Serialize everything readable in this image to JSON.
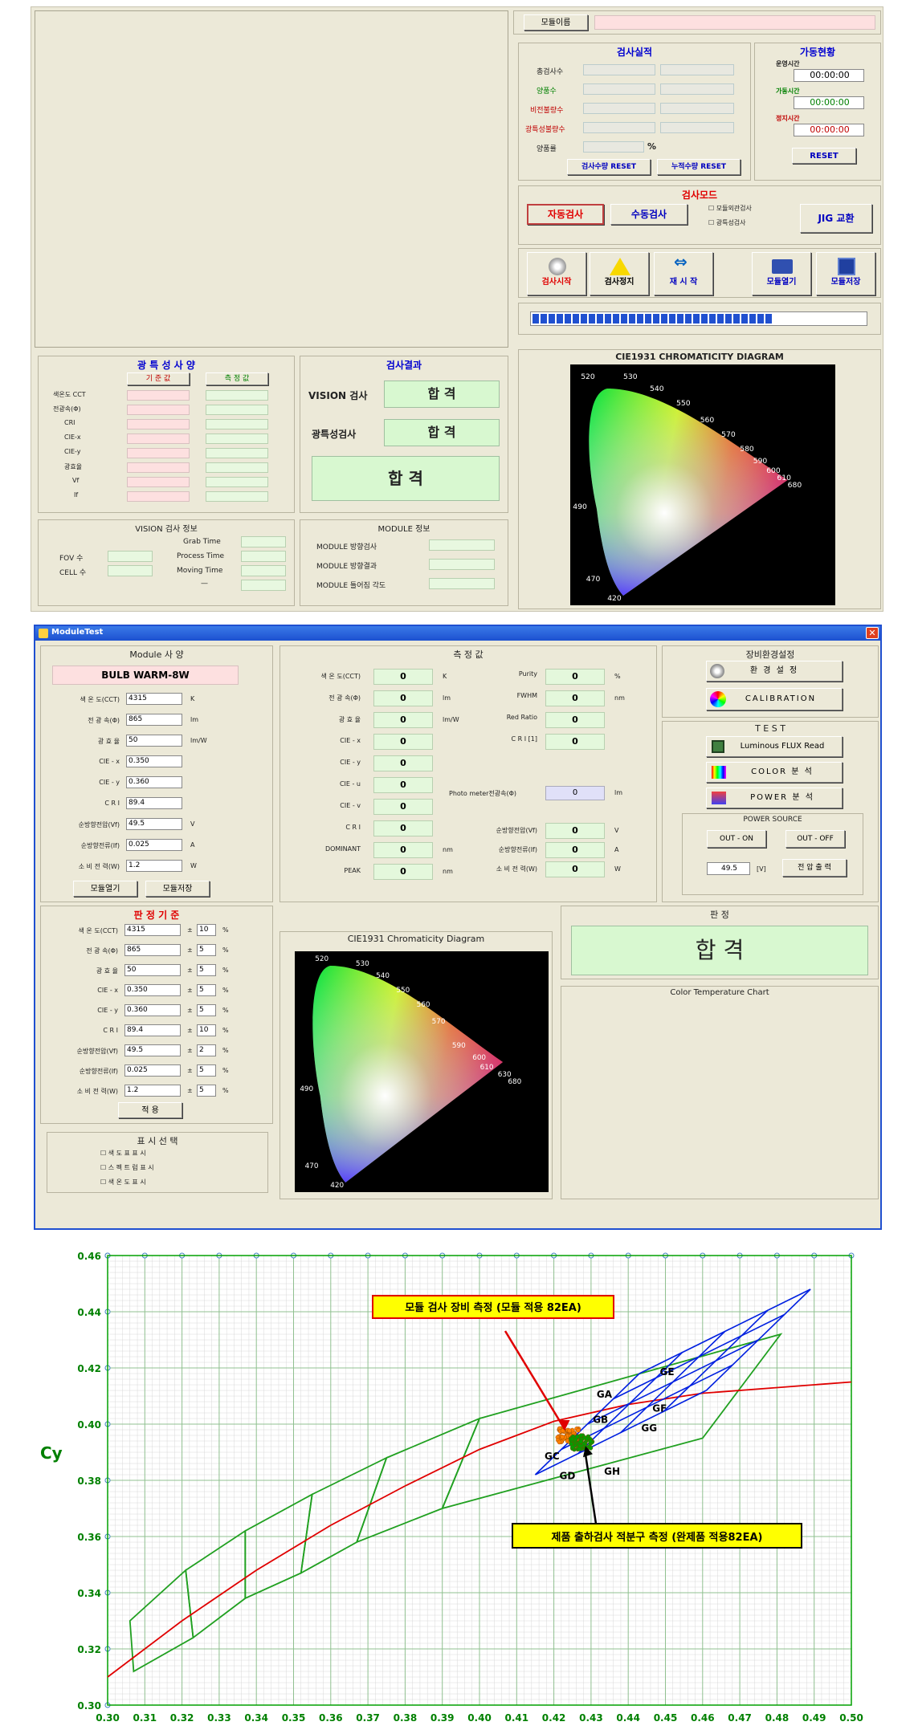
{
  "top": {
    "module_name_label": "모듈이름",
    "inspection_title": "검사실적",
    "counts": [
      "총검사수",
      "양품수",
      "비전불량수",
      "광특성불량수",
      "양품률"
    ],
    "percent": "%",
    "reset_count": "검사수량 RESET",
    "reset_accum": "누적수량 RESET",
    "status_title": "가동현황",
    "run_label": "운영시간",
    "run": "00:00:00",
    "op_label": "가동시간",
    "op": "00:00:00",
    "stop_label": "정지시간",
    "stop": "00:00:00",
    "reset": "RESET",
    "mode_title": "검사모드",
    "auto": "자동검사",
    "manual": "수동검사",
    "chk1": "모듈외관검사",
    "chk2": "광특성검사",
    "jig": "JIG 교환",
    "start": "검사시작",
    "stopbtn": "검사정지",
    "restart": "재 시 작",
    "open": "모듈열기",
    "save": "모듈저장",
    "spec_title": "광 특 성 사 양",
    "ref": "기 준 값",
    "meas": "측 정 값",
    "spec_rows": [
      "색온도 CCT",
      "전광속(Φ)",
      "CRI",
      "CIE-x",
      "CIE-y",
      "광효율",
      "Vf",
      "If"
    ],
    "result_title": "검사결과",
    "vision": "VISION 검사",
    "optic": "광특성검사",
    "pass": "합 격",
    "pass_big": "합 격",
    "vision_info": "VISION 검사 정보",
    "fov": "FOV 수",
    "cell": "CELL 수",
    "grab": "Grab Time",
    "proc": "Process Time",
    "move": "Moving Time",
    "dash": "—",
    "module_info": "MODULE 정보",
    "mi": [
      "MODULE 방향검사",
      "MODULE 방향결과",
      "MODULE 틀어짐 각도"
    ],
    "cie_title": "CIE1931 CHROMATICITY DIAGRAM"
  },
  "win": {
    "title": "ModuleTest",
    "spec_title": "Module 사 양",
    "model": "BULB WARM-8W",
    "spec": [
      {
        "l": "색 온 도(CCT)",
        "v": "4315",
        "u": "K"
      },
      {
        "l": "전 광 속(Φ)",
        "v": "865",
        "u": "lm"
      },
      {
        "l": "광 효 율",
        "v": "50",
        "u": "lm/W"
      },
      {
        "l": "CIE - x",
        "v": "0.350",
        "u": ""
      },
      {
        "l": "CIE - y",
        "v": "0.360",
        "u": ""
      },
      {
        "l": "C R I",
        "v": "89.4",
        "u": ""
      },
      {
        "l": "순방향전압(Vf)",
        "v": "49.5",
        "u": "V"
      },
      {
        "l": "순방향전류(If)",
        "v": "0.025",
        "u": "A"
      },
      {
        "l": "소 비 전 력(W)",
        "v": "1.2",
        "u": "W"
      }
    ],
    "open": "모듈열기",
    "save": "모듈저장",
    "meas_title": "측 정 값",
    "meas": [
      {
        "l": "색 온 도(CCT)",
        "v": "0",
        "u": "K"
      },
      {
        "l": "전 광 속(Φ)",
        "v": "0",
        "u": "lm"
      },
      {
        "l": "광 효 율",
        "v": "0",
        "u": "lm/W"
      },
      {
        "l": "CIE - x",
        "v": "0",
        "u": ""
      },
      {
        "l": "CIE - y",
        "v": "0",
        "u": ""
      },
      {
        "l": "CIE - u",
        "v": "0",
        "u": ""
      },
      {
        "l": "CIE - v",
        "v": "0",
        "u": ""
      },
      {
        "l": "C R I",
        "v": "0",
        "u": ""
      },
      {
        "l": "DOMINANT",
        "v": "0",
        "u": "nm"
      },
      {
        "l": "PEAK",
        "v": "0",
        "u": "nm"
      }
    ],
    "meas2": [
      {
        "l": "Purity",
        "v": "0",
        "u": "%"
      },
      {
        "l": "FWHM",
        "v": "0",
        "u": "nm"
      },
      {
        "l": "Red Ratio",
        "v": "0",
        "u": ""
      },
      {
        "l": "C R I [1]",
        "v": "0",
        "u": ""
      }
    ],
    "photo_label": "Photo meter전광속(Φ)",
    "photo": "0",
    "photo_u": "lm",
    "meas3": [
      {
        "l": "순방향전압(Vf)",
        "v": "0",
        "u": "V"
      },
      {
        "l": "순방향전류(If)",
        "v": "0",
        "u": "A"
      },
      {
        "l": "소 비 전 력(W)",
        "v": "0",
        "u": "W"
      }
    ],
    "env_title": "장비환경설정",
    "env": "환 경 설 정",
    "calib": "CALIBRATION",
    "test_title": "T E S T",
    "lum": "Luminous FLUX Read",
    "color": "COLOR 분 석",
    "power": "POWER 분 석",
    "ps_title": "POWER SOURCE",
    "on": "OUT - ON",
    "off": "OUT - OFF",
    "volt": "49.5",
    "vunit": "[V]",
    "vout": "전 압 출 력",
    "judge_title": "판 정 기 준",
    "judge": [
      {
        "l": "색 온 도(CCT)",
        "v": "4315",
        "t": "10"
      },
      {
        "l": "전 광 속(Φ)",
        "v": "865",
        "t": "5"
      },
      {
        "l": "광 효 율",
        "v": "50",
        "t": "5"
      },
      {
        "l": "CIE - x",
        "v": "0.350",
        "t": "5"
      },
      {
        "l": "CIE - y",
        "v": "0.360",
        "t": "5"
      },
      {
        "l": "C R I",
        "v": "89.4",
        "t": "10"
      },
      {
        "l": "순방향전압(Vf)",
        "v": "49.5",
        "t": "2"
      },
      {
        "l": "순방향전류(If)",
        "v": "0.025",
        "t": "5"
      },
      {
        "l": "소 비 전 력(W)",
        "v": "1.2",
        "t": "5"
      }
    ],
    "pm": "±",
    "pct": "%",
    "apply": "적 용",
    "disp_title": "표 시 선 택",
    "disp": [
      "색 도 표 표 시",
      "스 펙 트 럼 표 시",
      "색 온 도 표 시"
    ],
    "cie_title": "CIE1931 Chromaticity Diagram",
    "judge2_title": "판 정",
    "result": "합 격",
    "ct_title": "Color Temperature Chart"
  },
  "chart_data": {
    "type": "scatter",
    "ylabel": "Cy",
    "xlim": [
      0.3,
      0.5
    ],
    "ylim": [
      0.3,
      0.46
    ],
    "xticks": [
      "0.30",
      "0.31",
      "0.32",
      "0.33",
      "0.34",
      "0.35",
      "0.36",
      "0.37",
      "0.38",
      "0.39",
      "0.40",
      "0.41",
      "0.42",
      "0.43",
      "0.44",
      "0.45",
      "0.46",
      "0.47",
      "0.48",
      "0.49",
      "0.50"
    ],
    "yticks": [
      "0.30",
      "0.32",
      "0.34",
      "0.36",
      "0.38",
      "0.40",
      "0.42",
      "0.44",
      "0.46"
    ],
    "planck": [
      [
        0.3,
        0.31
      ],
      [
        0.32,
        0.33
      ],
      [
        0.34,
        0.348
      ],
      [
        0.36,
        0.364
      ],
      [
        0.38,
        0.378
      ],
      [
        0.4,
        0.391
      ],
      [
        0.42,
        0.401
      ],
      [
        0.44,
        0.407
      ],
      [
        0.46,
        0.411
      ],
      [
        0.48,
        0.413
      ],
      [
        0.5,
        0.415
      ]
    ],
    "bins": [
      "GA",
      "GB",
      "GC",
      "GD",
      "GE",
      "GF",
      "GG",
      "GH"
    ],
    "ann1": "모듈 검사 장비 측정 (모듈 적용 82EA)",
    "ann2": "제품 출하검사 적분구 측정 (완제품 적용82EA)",
    "clusters": [
      {
        "name": "orange",
        "color": "#ff8000",
        "cx": 0.424,
        "cy": 0.396
      },
      {
        "name": "green",
        "color": "#00a000",
        "cx": 0.4275,
        "cy": 0.3935
      }
    ],
    "colors": {
      "grid": "#00a000",
      "planck": "#e00000",
      "bin": "#0020e0"
    }
  }
}
